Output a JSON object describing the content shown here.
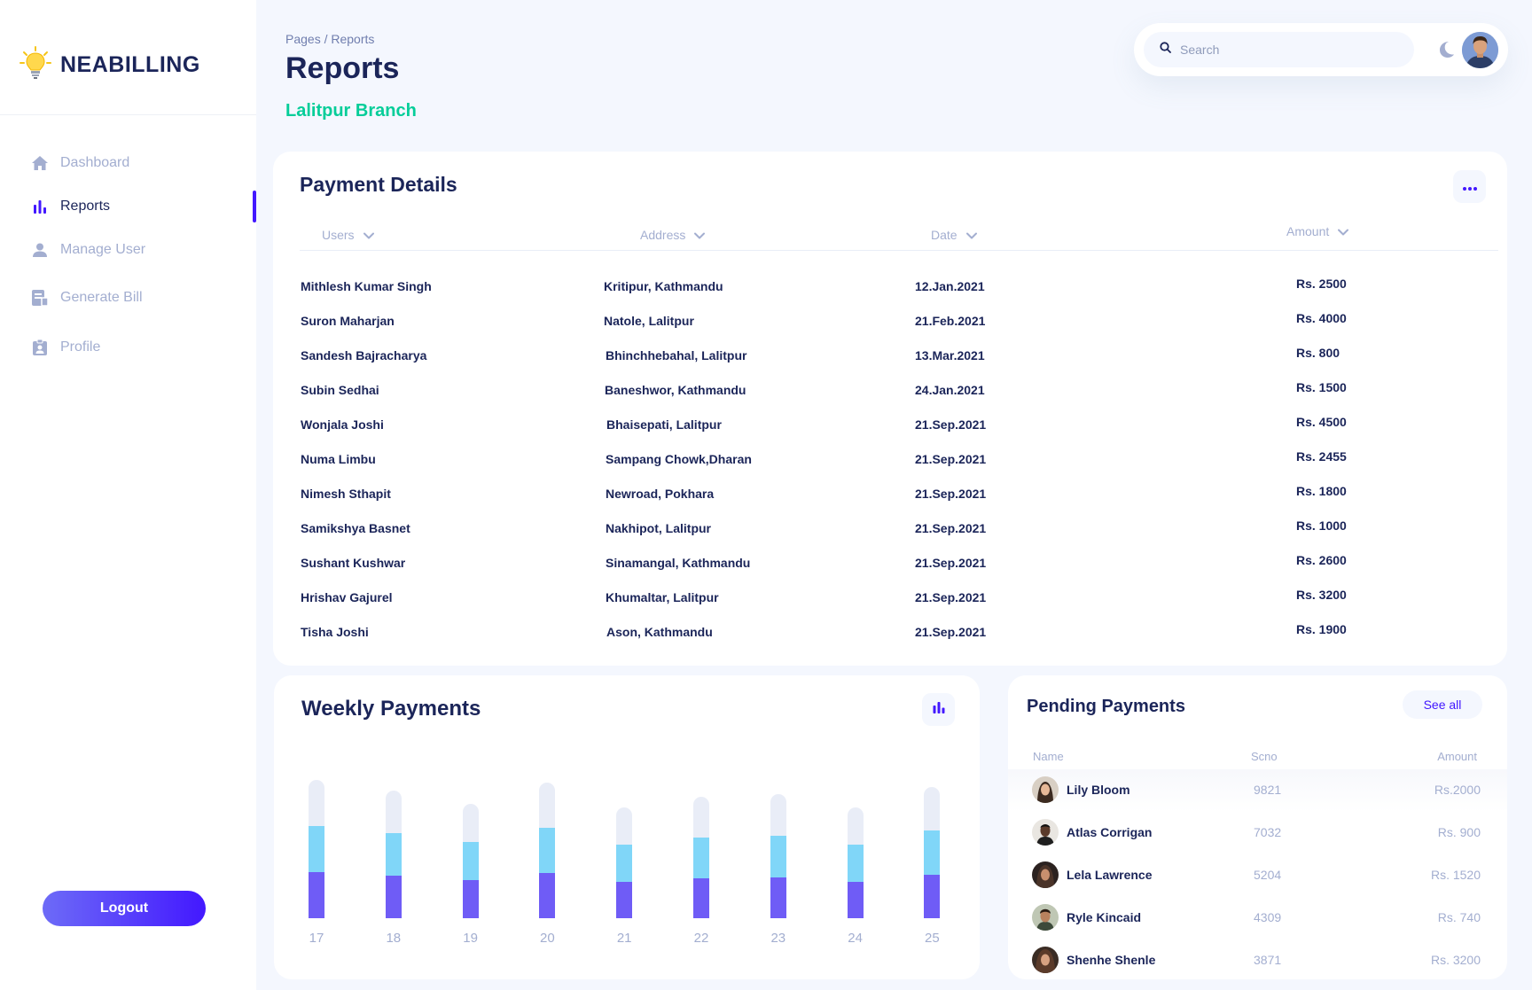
{
  "brand": {
    "name": "NEABILLING",
    "logo_icon": "lightbulb-icon"
  },
  "sidebar": {
    "items": [
      {
        "label": "Dashboard",
        "icon": "home-icon",
        "active": false
      },
      {
        "label": "Reports",
        "icon": "bar-chart-icon",
        "active": true
      },
      {
        "label": "Manage User",
        "icon": "user-icon",
        "active": false
      },
      {
        "label": "Generate Bill",
        "icon": "bill-icon",
        "active": false
      },
      {
        "label": "Profile",
        "icon": "id-badge-icon",
        "active": false
      }
    ],
    "logout_label": "Logout"
  },
  "header": {
    "breadcrumb": "Pages / Reports",
    "title": "Reports",
    "branch": "Lalitpur Branch",
    "search_placeholder": "Search"
  },
  "payment_details": {
    "title": "Payment Details",
    "columns": [
      "Users",
      "Address",
      "Date",
      "Amount"
    ],
    "rows": [
      {
        "user": "Mithlesh Kumar Singh",
        "address": "Kritipur, Kathmandu",
        "date": "12.Jan.2021",
        "amount": "Rs. 2500"
      },
      {
        "user": "Suron Maharjan",
        "address": "Natole, Lalitpur",
        "date": "21.Feb.2021",
        "amount": "Rs. 4000"
      },
      {
        "user": "Sandesh Bajracharya",
        "address": "Bhinchhebahal, Lalitpur",
        "date": "13.Mar.2021",
        "amount": "Rs. 800"
      },
      {
        "user": "Subin Sedhai",
        "address": "Baneshwor, Kathmandu",
        "date": "24.Jan.2021",
        "amount": "Rs. 1500"
      },
      {
        "user": "Wonjala Joshi",
        "address": "Bhaisepati, Lalitpur",
        "date": "21.Sep.2021",
        "amount": "Rs. 4500"
      },
      {
        "user": "Numa Limbu",
        "address": "Sampang Chowk,Dharan",
        "date": "21.Sep.2021",
        "amount": "Rs. 2455"
      },
      {
        "user": "Nimesh Sthapit",
        "address": "Newroad, Pokhara",
        "date": "21.Sep.2021",
        "amount": "Rs. 1800"
      },
      {
        "user": "Samikshya Basnet",
        "address": "Nakhipot, Lalitpur",
        "date": "21.Sep.2021",
        "amount": "Rs. 1000"
      },
      {
        "user": "Sushant Kushwar",
        "address": "Sinamangal, Kathmandu",
        "date": "21.Sep.2021",
        "amount": "Rs. 2600"
      },
      {
        "user": "Hrishav Gajurel",
        "address": "Khumaltar, Lalitpur",
        "date": "21.Sep.2021",
        "amount": "Rs. 3200"
      },
      {
        "user": "Tisha Joshi",
        "address": "Ason, Kathmandu",
        "date": "21.Sep.2021",
        "amount": "Rs. 1900"
      }
    ]
  },
  "weekly_payments": {
    "title": "Weekly Payments"
  },
  "chart_data": {
    "type": "bar",
    "stacked": true,
    "categories": [
      "17",
      "18",
      "19",
      "20",
      "21",
      "22",
      "23",
      "24",
      "25"
    ],
    "series": [
      {
        "values": [
          52,
          48,
          43,
          51,
          41,
          45,
          46,
          41,
          49
        ],
        "color": "#6f5cf6"
      },
      {
        "values": [
          52,
          48,
          43,
          51,
          42,
          46,
          47,
          42,
          50
        ],
        "color": "#80d6f8"
      },
      {
        "values": [
          52,
          48,
          43,
          51,
          42,
          46,
          47,
          42,
          49
        ],
        "color": "#e9edf7"
      }
    ],
    "xlabel": "",
    "ylabel": "",
    "grid": false
  },
  "pending_payments": {
    "title": "Pending Payments",
    "see_all_label": "See all",
    "columns": [
      "Name",
      "Scno",
      "Amount"
    ],
    "rows": [
      {
        "name": "Lily Bloom",
        "scno": "9821",
        "amount": "Rs.2000"
      },
      {
        "name": "Atlas Corrigan",
        "scno": "7032",
        "amount": "Rs. 900"
      },
      {
        "name": "Lela Lawrence",
        "scno": "5204",
        "amount": "Rs. 1520"
      },
      {
        "name": "Ryle Kincaid",
        "scno": "4309",
        "amount": "Rs. 740"
      },
      {
        "name": "Shenhe Shenle",
        "scno": "3871",
        "amount": "Rs. 3200"
      }
    ]
  },
  "colors": {
    "accent": "#4318ff",
    "branch_green": "#05cd99",
    "text_dark": "#1b2559",
    "text_muted": "#a3aed0",
    "background": "#f4f7fe"
  }
}
